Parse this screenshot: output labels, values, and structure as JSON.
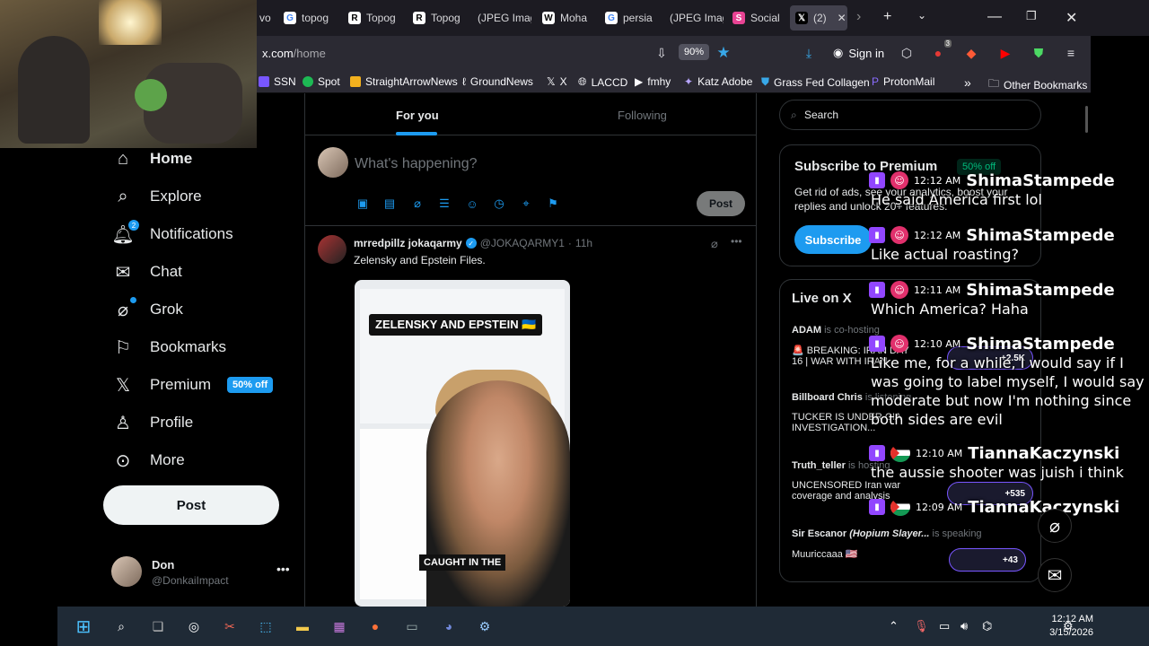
{
  "browser": {
    "tabs": [
      {
        "label": "vo"
      },
      {
        "label": "topog"
      },
      {
        "label": "Topog"
      },
      {
        "label": "Topog"
      },
      {
        "label": "(JPEG Imag"
      },
      {
        "label": "Moha"
      },
      {
        "label": "persia"
      },
      {
        "label": "(JPEG Imag"
      },
      {
        "label": "Social"
      },
      {
        "label": "(2)"
      }
    ],
    "url_host": "x.com",
    "url_path": "/home",
    "zoom": "90%",
    "sign_in": "Sign in",
    "extension_badge": "3",
    "bookmarks": [
      "SSN",
      "Spot",
      "StraightArrowNews",
      "GroundNews",
      "X",
      "LACCD",
      "fmhy",
      "Katz Adobe",
      "Grass Fed Collagen",
      "ProtonMail"
    ],
    "other_bookmarks": "Other Bookmarks"
  },
  "sidebar": {
    "items": [
      {
        "label": "Home",
        "icon": "home-icon"
      },
      {
        "label": "Explore",
        "icon": "search-icon"
      },
      {
        "label": "Notifications",
        "icon": "bell-icon",
        "badge": "2"
      },
      {
        "label": "Chat",
        "icon": "mail-icon"
      },
      {
        "label": "Grok",
        "icon": "grok-icon"
      },
      {
        "label": "Bookmarks",
        "icon": "bookmark-icon"
      },
      {
        "label": "Premium",
        "icon": "x-logo-icon",
        "pill": "50% off"
      },
      {
        "label": "Profile",
        "icon": "person-icon"
      },
      {
        "label": "More",
        "icon": "more-circle-icon"
      }
    ],
    "post_button": "Post",
    "account": {
      "name": "Don",
      "handle": "@DonkaiImpact"
    }
  },
  "timeline": {
    "tabs": [
      "For you",
      "Following"
    ],
    "compose_placeholder": "What's happening?",
    "compose_post": "Post",
    "tweet": {
      "name": "mrredpillz jokaqarmy",
      "handle": "@JOKAQARMY1",
      "time": "11h",
      "text": "Zelensky and Epstein Files.",
      "media_headline": "ZELENSKY AND EPSTEIN 🇺🇦",
      "media_caption": "CAUGHT IN THE"
    }
  },
  "right": {
    "search_placeholder": "Search",
    "premium": {
      "title": "Subscribe to Premium",
      "badge": "50% off",
      "body_line1": "Get rid of ads, see your analytics, boost your",
      "body_line2": "replies and unlock 20+ features.",
      "button": "Subscribe"
    },
    "live": {
      "title": "Live on X",
      "spaces": [
        {
          "host": "ADAM",
          "status": "is co-hosting",
          "title1": "🚨 BREAKING: IRAN DAY",
          "title2": "16 | WAR WITH IRAN",
          "count": "+2.5K"
        },
        {
          "host": "Billboard Chris",
          "status": "is listening",
          "title1": "TUCKER IS UNDER CIA",
          "title2": "INVESTIGATION...",
          "count": ""
        },
        {
          "host": "Truth_teller",
          "status": "is hosting",
          "title1": "UNCENSORED Iran war",
          "title2": "coverage and analysis",
          "count": "+535"
        },
        {
          "host": "Sir Escanor",
          "host_extra": "(Hopium Slayer...",
          "status": "is speaking",
          "title1": "Muuriccaaa 🇺🇸",
          "title2": "",
          "count": "+43"
        }
      ]
    }
  },
  "chat_overlay": {
    "messages": [
      {
        "time": "12:12 AM",
        "user": "ShimaStampede",
        "text": "He said America first lol"
      },
      {
        "time": "12:12 AM",
        "user": "ShimaStampede",
        "text": "Like actual roasting?"
      },
      {
        "time": "12:11 AM",
        "user": "ShimaStampede",
        "text": "Which America? Haha"
      },
      {
        "time": "12:10 AM",
        "user": "ShimaStampede",
        "text": "Like me, for a while, I would say if I was going to label myself, I would say moderate but now I'm nothing since both sides are evil"
      },
      {
        "time": "12:10 AM",
        "user": "TiannaKaczynski",
        "text": "the aussie shooter was juish i think"
      },
      {
        "time": "12:09 AM",
        "user": "TiannaKaczynski",
        "text": ""
      }
    ]
  },
  "taskbar": {
    "time": "12:12 AM",
    "date": "3/15/2026"
  },
  "colors": {
    "x_blue": "#1d9bf0",
    "twitch_purple": "#9146ff",
    "background": "#000000",
    "border": "#2f3336"
  }
}
